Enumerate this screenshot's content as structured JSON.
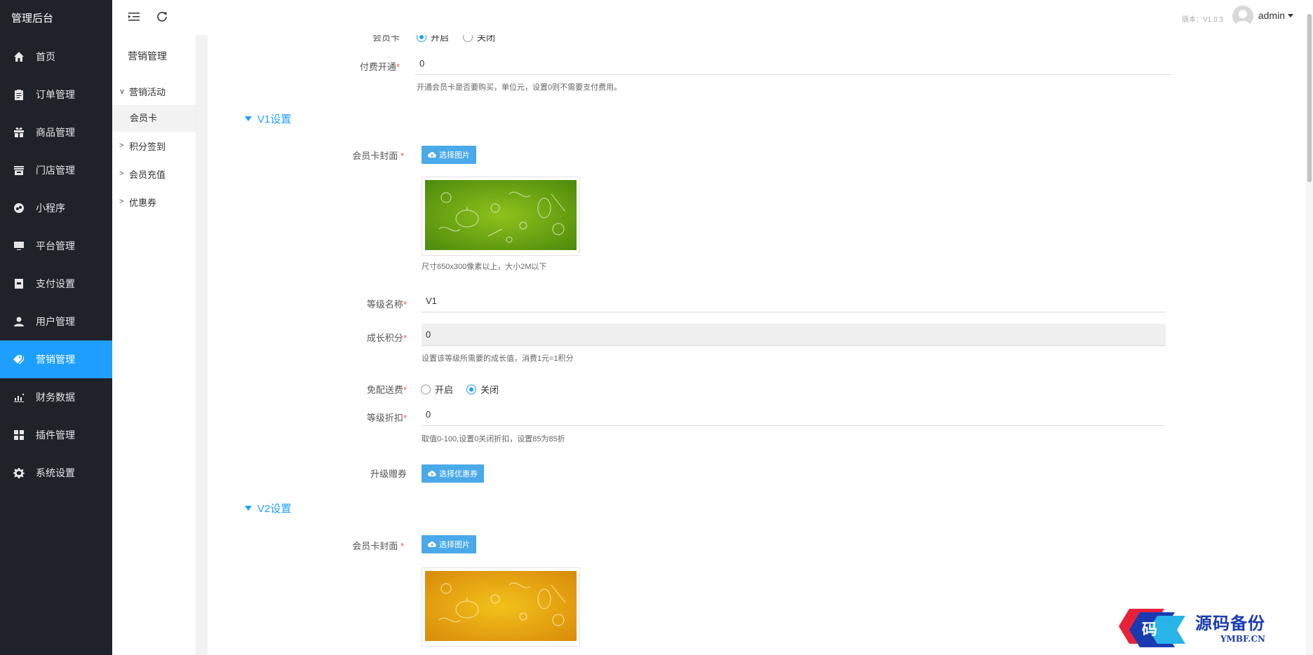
{
  "sidebar": {
    "brand": "管理后台",
    "items": [
      {
        "label": "首页",
        "icon": "home-icon"
      },
      {
        "label": "订单管理",
        "icon": "clipboard-icon"
      },
      {
        "label": "商品管理",
        "icon": "gift-icon"
      },
      {
        "label": "门店管理",
        "icon": "store-icon"
      },
      {
        "label": "小程序",
        "icon": "miniapp-icon"
      },
      {
        "label": "平台管理",
        "icon": "monitor-icon"
      },
      {
        "label": "支付设置",
        "icon": "wallet-icon"
      },
      {
        "label": "用户管理",
        "icon": "user-icon"
      },
      {
        "label": "营销管理",
        "icon": "tag-icon",
        "active": true
      },
      {
        "label": "财务数据",
        "icon": "bar-chart-icon"
      },
      {
        "label": "插件管理",
        "icon": "plugin-icon"
      },
      {
        "label": "系统设置",
        "icon": "gear-icon"
      }
    ],
    "active_color": "#1e9fff",
    "bg_color": "#20222a"
  },
  "header": {
    "version": "版本：V1.0.3",
    "username": "admin"
  },
  "subnav": {
    "title": "营销管理",
    "groups": [
      {
        "label": "营销活动",
        "expanded": true,
        "children": [
          "会员卡"
        ]
      },
      {
        "label": "积分签到",
        "expanded": false
      },
      {
        "label": "会员充值",
        "expanded": false
      },
      {
        "label": "优惠券",
        "expanded": false
      }
    ]
  },
  "form": {
    "member_card": {
      "label": "会员卡",
      "options": [
        "开启",
        "关闭"
      ],
      "selected": "开启"
    },
    "paid_open": {
      "label": "付费开通",
      "value": "0",
      "hint": "开通会员卡是否要购买，单位元，设置0则不需要支付费用。"
    },
    "v1": {
      "title": "V1设置",
      "cover_label": "会员卡封面",
      "choose_image": "选择图片",
      "cover_hint": "尺寸650x300像素以上，大小2M以下",
      "level_name_label": "等级名称",
      "level_name_value": "V1",
      "growth_label": "成长积分",
      "growth_value": "0",
      "growth_hint": "设置该等级所需要的成长值，消费1元=1积分",
      "free_delivery_label": "免配送费",
      "free_delivery_options": [
        "开启",
        "关闭"
      ],
      "free_delivery_selected": "关闭",
      "discount_label": "等级折扣",
      "discount_value": "0",
      "discount_hint": "取值0-100,设置0关闭折扣，设置85为85折",
      "upgrade_label": "升级赠券",
      "choose_coupon": "选择优惠券"
    },
    "v2": {
      "title": "V2设置",
      "cover_label": "会员卡封面",
      "choose_image": "选择图片"
    }
  },
  "watermark": {
    "cn": "源码备份",
    "en": "YMBF.CN",
    "glyph": "码"
  }
}
